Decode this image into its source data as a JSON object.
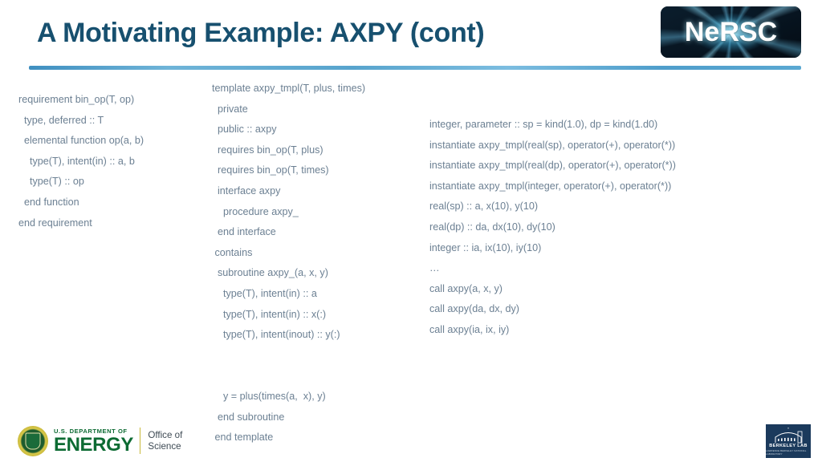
{
  "slide": {
    "title": "A Motivating Example: AXPY (cont)",
    "title_color": "#17506f",
    "rule_color": "#5aa8d2",
    "body_text_color": "#6c8093",
    "background_color": "#ffffff"
  },
  "nersc_logo": {
    "wordmark": "NeRSC",
    "background_color": "#071420",
    "ray_color": "#8fdcff"
  },
  "columns": {
    "left": {
      "name": "requirement-block",
      "lines": [
        "requirement bin_op(T, op)",
        "  type, deferred :: T",
        "  elemental function op(a, b)",
        "    type(T), intent(in) :: a, b",
        "    type(T) :: op",
        "  end function",
        "end requirement"
      ]
    },
    "middle": {
      "name": "template-block",
      "lines": [
        "template axpy_tmpl(T, plus, times)",
        "  private",
        "  public :: axpy",
        "  requires bin_op(T, plus)",
        "  requires bin_op(T, times)",
        "  interface axpy",
        "    procedure axpy_",
        "  end interface",
        " contains",
        "  subroutine axpy_(a, x, y)",
        "    type(T), intent(in) :: a",
        "    type(T), intent(in) :: x(:)",
        "    type(T), intent(inout) :: y(:)",
        "",
        "",
        "    y = plus(times(a,  x), y)",
        "  end subroutine",
        " end template"
      ]
    },
    "right": {
      "name": "instantiation-block",
      "lines": [
        "integer, parameter :: sp = kind(1.0), dp = kind(1.d0)",
        "instantiate axpy_tmpl(real(sp), operator(+), operator(*))",
        "instantiate axpy_tmpl(real(dp), operator(+), operator(*))",
        "instantiate axpy_tmpl(integer, operator(+), operator(*))",
        "real(sp) :: a, x(10), y(10)",
        "real(dp) :: da, dx(10), dy(10)",
        "integer :: ia, ix(10), iy(10)",
        "…",
        "call axpy(a, x, y)",
        "call axpy(da, dx, dy)",
        "call axpy(ia, ix, iy)"
      ]
    }
  },
  "footer": {
    "doe": {
      "department_line": "U.S. DEPARTMENT OF",
      "energy_word": "ENERGY",
      "office_line1": "Office of",
      "office_line2": "Science",
      "brand_color": "#0d6b33"
    },
    "berkeley": {
      "name": "BERKELEY LAB",
      "subtitle": "LAWRENCE BERKELEY NATIONAL LABORATORY",
      "background_color": "#1b3a5c"
    }
  }
}
